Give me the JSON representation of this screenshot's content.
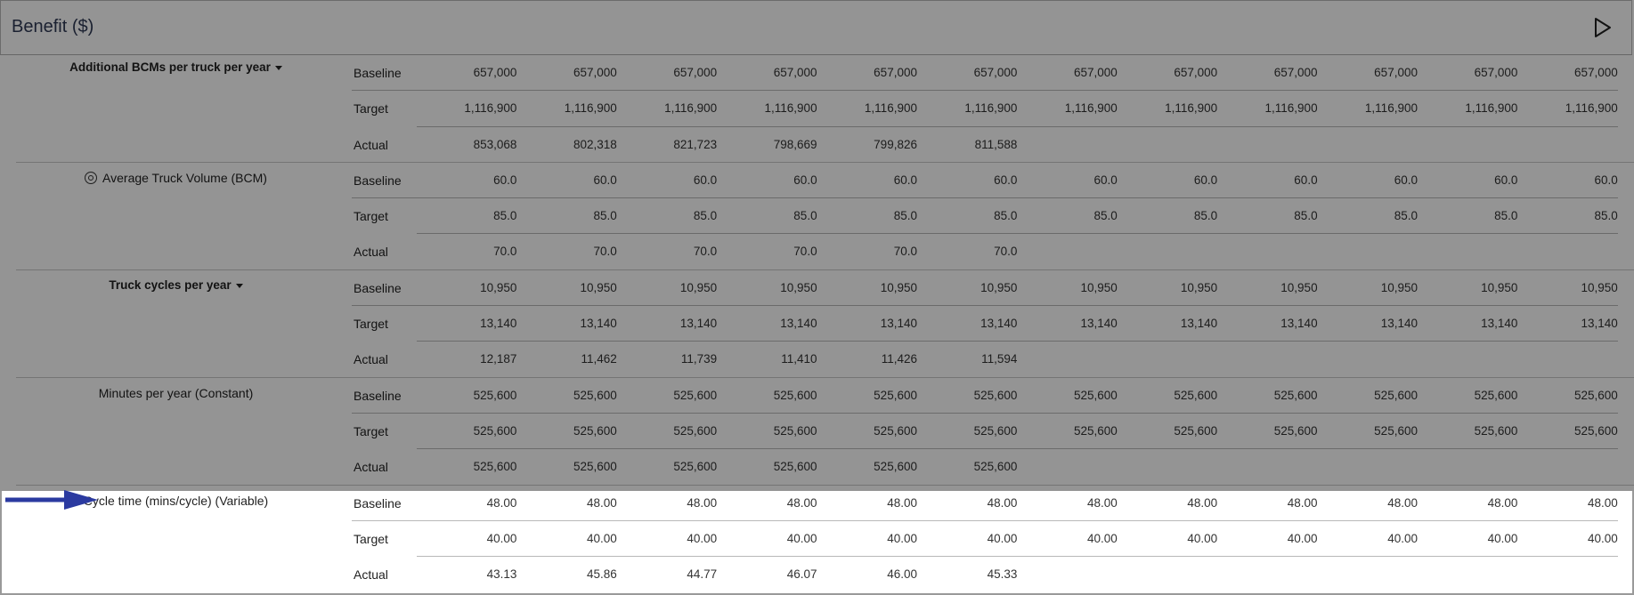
{
  "header": {
    "title": "Benefit ($)",
    "play_icon": "play-icon"
  },
  "groups": [
    {
      "label": "Additional BCMs per truck per year",
      "bold": true,
      "has_dropdown": true,
      "has_target_icon": false,
      "rows": [
        {
          "label": "Baseline",
          "values": [
            "657,000",
            "657,000",
            "657,000",
            "657,000",
            "657,000",
            "657,000",
            "657,000",
            "657,000",
            "657,000",
            "657,000",
            "657,000",
            "657,000"
          ]
        },
        {
          "label": "Target",
          "values": [
            "1,116,900",
            "1,116,900",
            "1,116,900",
            "1,116,900",
            "1,116,900",
            "1,116,900",
            "1,116,900",
            "1,116,900",
            "1,116,900",
            "1,116,900",
            "1,116,900",
            "1,116,900"
          ]
        },
        {
          "label": "Actual",
          "values": [
            "853,068",
            "802,318",
            "821,723",
            "798,669",
            "799,826",
            "811,588",
            "",
            "",
            "",
            "",
            "",
            ""
          ]
        }
      ]
    },
    {
      "label": "Average Truck Volume (BCM)",
      "bold": false,
      "has_dropdown": false,
      "has_target_icon": true,
      "rows": [
        {
          "label": "Baseline",
          "values": [
            "60.0",
            "60.0",
            "60.0",
            "60.0",
            "60.0",
            "60.0",
            "60.0",
            "60.0",
            "60.0",
            "60.0",
            "60.0",
            "60.0"
          ]
        },
        {
          "label": "Target",
          "values": [
            "85.0",
            "85.0",
            "85.0",
            "85.0",
            "85.0",
            "85.0",
            "85.0",
            "85.0",
            "85.0",
            "85.0",
            "85.0",
            "85.0"
          ]
        },
        {
          "label": "Actual",
          "values": [
            "70.0",
            "70.0",
            "70.0",
            "70.0",
            "70.0",
            "70.0",
            "",
            "",
            "",
            "",
            "",
            ""
          ]
        }
      ]
    },
    {
      "label": "Truck cycles per year",
      "bold": true,
      "has_dropdown": true,
      "has_target_icon": false,
      "rows": [
        {
          "label": "Baseline",
          "values": [
            "10,950",
            "10,950",
            "10,950",
            "10,950",
            "10,950",
            "10,950",
            "10,950",
            "10,950",
            "10,950",
            "10,950",
            "10,950",
            "10,950"
          ]
        },
        {
          "label": "Target",
          "values": [
            "13,140",
            "13,140",
            "13,140",
            "13,140",
            "13,140",
            "13,140",
            "13,140",
            "13,140",
            "13,140",
            "13,140",
            "13,140",
            "13,140"
          ]
        },
        {
          "label": "Actual",
          "values": [
            "12,187",
            "11,462",
            "11,739",
            "11,410",
            "11,426",
            "11,594",
            "",
            "",
            "",
            "",
            "",
            ""
          ]
        }
      ]
    },
    {
      "label": "Minutes per year (Constant)",
      "bold": false,
      "has_dropdown": false,
      "has_target_icon": false,
      "rows": [
        {
          "label": "Baseline",
          "values": [
            "525,600",
            "525,600",
            "525,600",
            "525,600",
            "525,600",
            "525,600",
            "525,600",
            "525,600",
            "525,600",
            "525,600",
            "525,600",
            "525,600"
          ]
        },
        {
          "label": "Target",
          "values": [
            "525,600",
            "525,600",
            "525,600",
            "525,600",
            "525,600",
            "525,600",
            "525,600",
            "525,600",
            "525,600",
            "525,600",
            "525,600",
            "525,600"
          ]
        },
        {
          "label": "Actual",
          "values": [
            "525,600",
            "525,600",
            "525,600",
            "525,600",
            "525,600",
            "525,600",
            "",
            "",
            "",
            "",
            "",
            ""
          ]
        }
      ]
    },
    {
      "label": "Cycle time (mins/cycle) (Variable)",
      "bold": false,
      "has_dropdown": false,
      "has_target_icon": false,
      "highlighted": true,
      "rows": [
        {
          "label": "Baseline",
          "values": [
            "48.00",
            "48.00",
            "48.00",
            "48.00",
            "48.00",
            "48.00",
            "48.00",
            "48.00",
            "48.00",
            "48.00",
            "48.00",
            "48.00"
          ]
        },
        {
          "label": "Target",
          "values": [
            "40.00",
            "40.00",
            "40.00",
            "40.00",
            "40.00",
            "40.00",
            "40.00",
            "40.00",
            "40.00",
            "40.00",
            "40.00",
            "40.00"
          ]
        },
        {
          "label": "Actual",
          "values": [
            "43.13",
            "45.86",
            "44.77",
            "46.07",
            "46.00",
            "45.33",
            "",
            "",
            "",
            "",
            "",
            ""
          ]
        }
      ]
    }
  ],
  "colors": {
    "overlay": "#000000",
    "arrow": "#2b3aa0",
    "title": "#2f3a55"
  }
}
